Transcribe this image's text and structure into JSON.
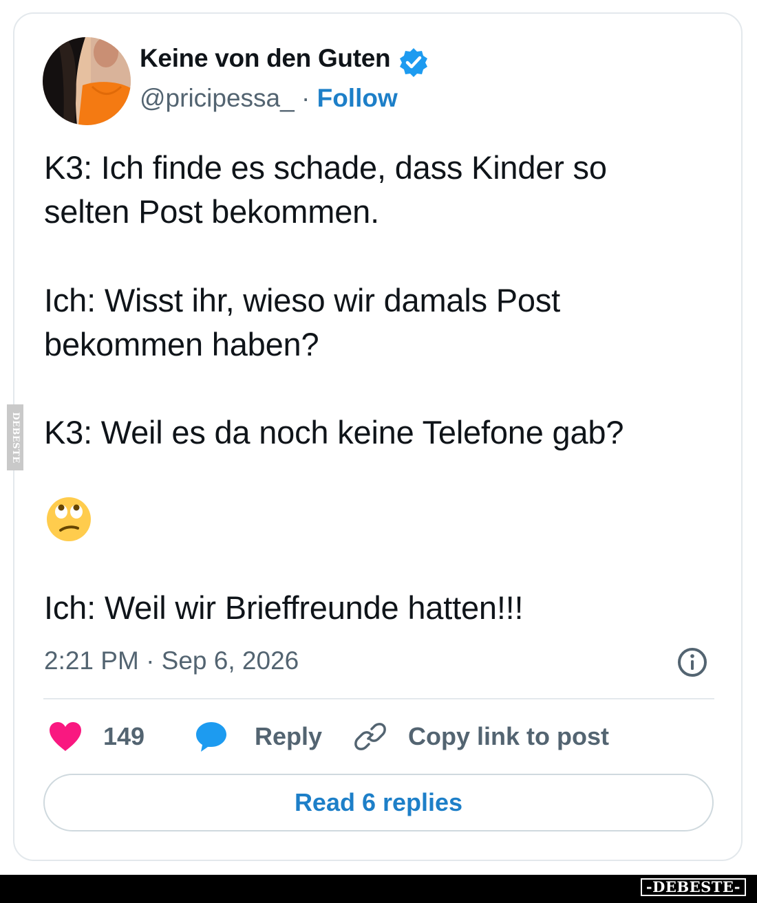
{
  "author": {
    "display_name": "Keine von den Guten",
    "handle": "@pricipessa_",
    "separator": "·",
    "follow_label": "Follow",
    "verified": true,
    "verified_icon": "verified-badge-icon"
  },
  "tweet": {
    "lines": [
      "K3: Ich finde es schade, dass Kinder so",
      "selten Post bekommen.",
      "Ich: Wisst ihr, wieso wir damals Post",
      "bekommen haben?",
      "K3: Weil es da noch keine Telefone gab?",
      "Ich: Weil wir Brieffreunde hatten!!!"
    ],
    "emoji": "face-with-rolling-eyes-icon",
    "timestamp": "2:21 PM · Sep 6, 2026"
  },
  "actions": {
    "like_count": "149",
    "reply_label": "Reply",
    "copy_link_label": "Copy link to post",
    "read_replies_label": "Read 6 replies"
  },
  "watermark": {
    "side_text": "DEBESTE",
    "brand_text": "-DEBESTE-"
  },
  "colors": {
    "text_primary": "#0f1419",
    "text_secondary": "#536471",
    "link_blue": "#1d7fc8",
    "verified_blue": "#1d9bf0",
    "like_pink": "#f91880",
    "border": "#e3e8ec"
  }
}
